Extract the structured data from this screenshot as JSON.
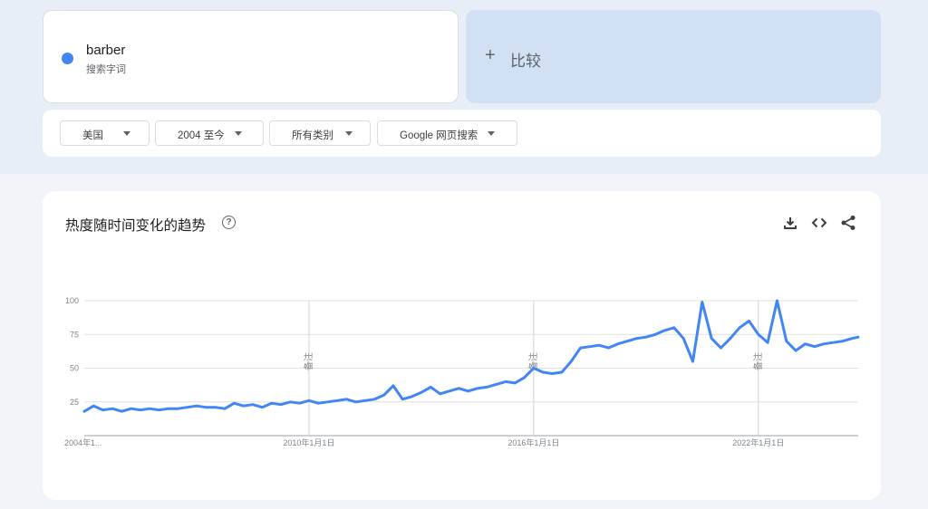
{
  "search_term": {
    "name": "barber",
    "type_label": "搜索字词",
    "color": "#4285f4"
  },
  "compare": {
    "plus": "+",
    "label": "比较"
  },
  "filters": {
    "region": "美国",
    "time_range": "2004 至今",
    "category": "所有类别",
    "property": "Google 网页搜索"
  },
  "chart_section": {
    "title": "热度随时间变化的趋势",
    "help_icon": "help-circle-icon",
    "actions": [
      "download-icon",
      "embed-code-icon",
      "share-icon"
    ]
  },
  "chart_data": {
    "type": "line",
    "title": "",
    "xlabel": "",
    "ylabel": "",
    "x_start": "2004-01",
    "x_end": "2024-09",
    "x_ticks": [
      {
        "date": "2004-01",
        "label": "2004年1..."
      },
      {
        "date": "2010-01",
        "label": "2010年1月1日"
      },
      {
        "date": "2016-01",
        "label": "2016年1月1日"
      },
      {
        "date": "2022-01",
        "label": "2022年1月1日"
      }
    ],
    "y_ticks": [
      "25",
      "50",
      "75",
      "100"
    ],
    "ylim": [
      0,
      100
    ],
    "grid": true,
    "annotation_lines": [
      {
        "date": "2010-01",
        "label": "备注"
      },
      {
        "date": "2016-01",
        "label": "备注"
      },
      {
        "date": "2022-01",
        "label": "备注"
      }
    ],
    "series": [
      {
        "color": "#4285f4",
        "points": [
          [
            "2004-01",
            18
          ],
          [
            "2004-04",
            22
          ],
          [
            "2004-07",
            19
          ],
          [
            "2004-10",
            20
          ],
          [
            "2005-01",
            18
          ],
          [
            "2005-04",
            20
          ],
          [
            "2005-07",
            19
          ],
          [
            "2005-10",
            20
          ],
          [
            "2006-01",
            19
          ],
          [
            "2006-04",
            20
          ],
          [
            "2006-07",
            20
          ],
          [
            "2006-10",
            21
          ],
          [
            "2007-01",
            22
          ],
          [
            "2007-04",
            21
          ],
          [
            "2007-07",
            21
          ],
          [
            "2007-10",
            20
          ],
          [
            "2008-01",
            24
          ],
          [
            "2008-04",
            22
          ],
          [
            "2008-07",
            23
          ],
          [
            "2008-10",
            21
          ],
          [
            "2009-01",
            24
          ],
          [
            "2009-04",
            23
          ],
          [
            "2009-07",
            25
          ],
          [
            "2009-10",
            24
          ],
          [
            "2010-01",
            26
          ],
          [
            "2010-04",
            24
          ],
          [
            "2010-07",
            25
          ],
          [
            "2010-10",
            26
          ],
          [
            "2011-01",
            27
          ],
          [
            "2011-04",
            25
          ],
          [
            "2011-07",
            26
          ],
          [
            "2011-10",
            27
          ],
          [
            "2012-01",
            30
          ],
          [
            "2012-04",
            37
          ],
          [
            "2012-07",
            27
          ],
          [
            "2012-10",
            29
          ],
          [
            "2013-01",
            32
          ],
          [
            "2013-04",
            36
          ],
          [
            "2013-07",
            31
          ],
          [
            "2013-10",
            33
          ],
          [
            "2014-01",
            35
          ],
          [
            "2014-04",
            33
          ],
          [
            "2014-07",
            35
          ],
          [
            "2014-10",
            36
          ],
          [
            "2015-01",
            38
          ],
          [
            "2015-04",
            40
          ],
          [
            "2015-07",
            39
          ],
          [
            "2015-10",
            43
          ],
          [
            "2016-01",
            50
          ],
          [
            "2016-04",
            47
          ],
          [
            "2016-07",
            46
          ],
          [
            "2016-10",
            47
          ],
          [
            "2017-01",
            55
          ],
          [
            "2017-04",
            65
          ],
          [
            "2017-07",
            66
          ],
          [
            "2017-10",
            67
          ],
          [
            "2018-01",
            65
          ],
          [
            "2018-04",
            68
          ],
          [
            "2018-07",
            70
          ],
          [
            "2018-10",
            72
          ],
          [
            "2019-01",
            73
          ],
          [
            "2019-04",
            75
          ],
          [
            "2019-07",
            78
          ],
          [
            "2019-10",
            80
          ],
          [
            "2020-01",
            72
          ],
          [
            "2020-04",
            55
          ],
          [
            "2020-07",
            99
          ],
          [
            "2020-10",
            72
          ],
          [
            "2021-01",
            65
          ],
          [
            "2021-04",
            72
          ],
          [
            "2021-07",
            80
          ],
          [
            "2021-10",
            85
          ],
          [
            "2022-01",
            75
          ],
          [
            "2022-04",
            69
          ],
          [
            "2022-07",
            100
          ],
          [
            "2022-10",
            70
          ],
          [
            "2023-01",
            63
          ],
          [
            "2023-04",
            68
          ],
          [
            "2023-07",
            66
          ],
          [
            "2023-10",
            68
          ],
          [
            "2024-01",
            69
          ],
          [
            "2024-04",
            70
          ],
          [
            "2024-07",
            72
          ],
          [
            "2024-09",
            73
          ]
        ]
      }
    ]
  }
}
